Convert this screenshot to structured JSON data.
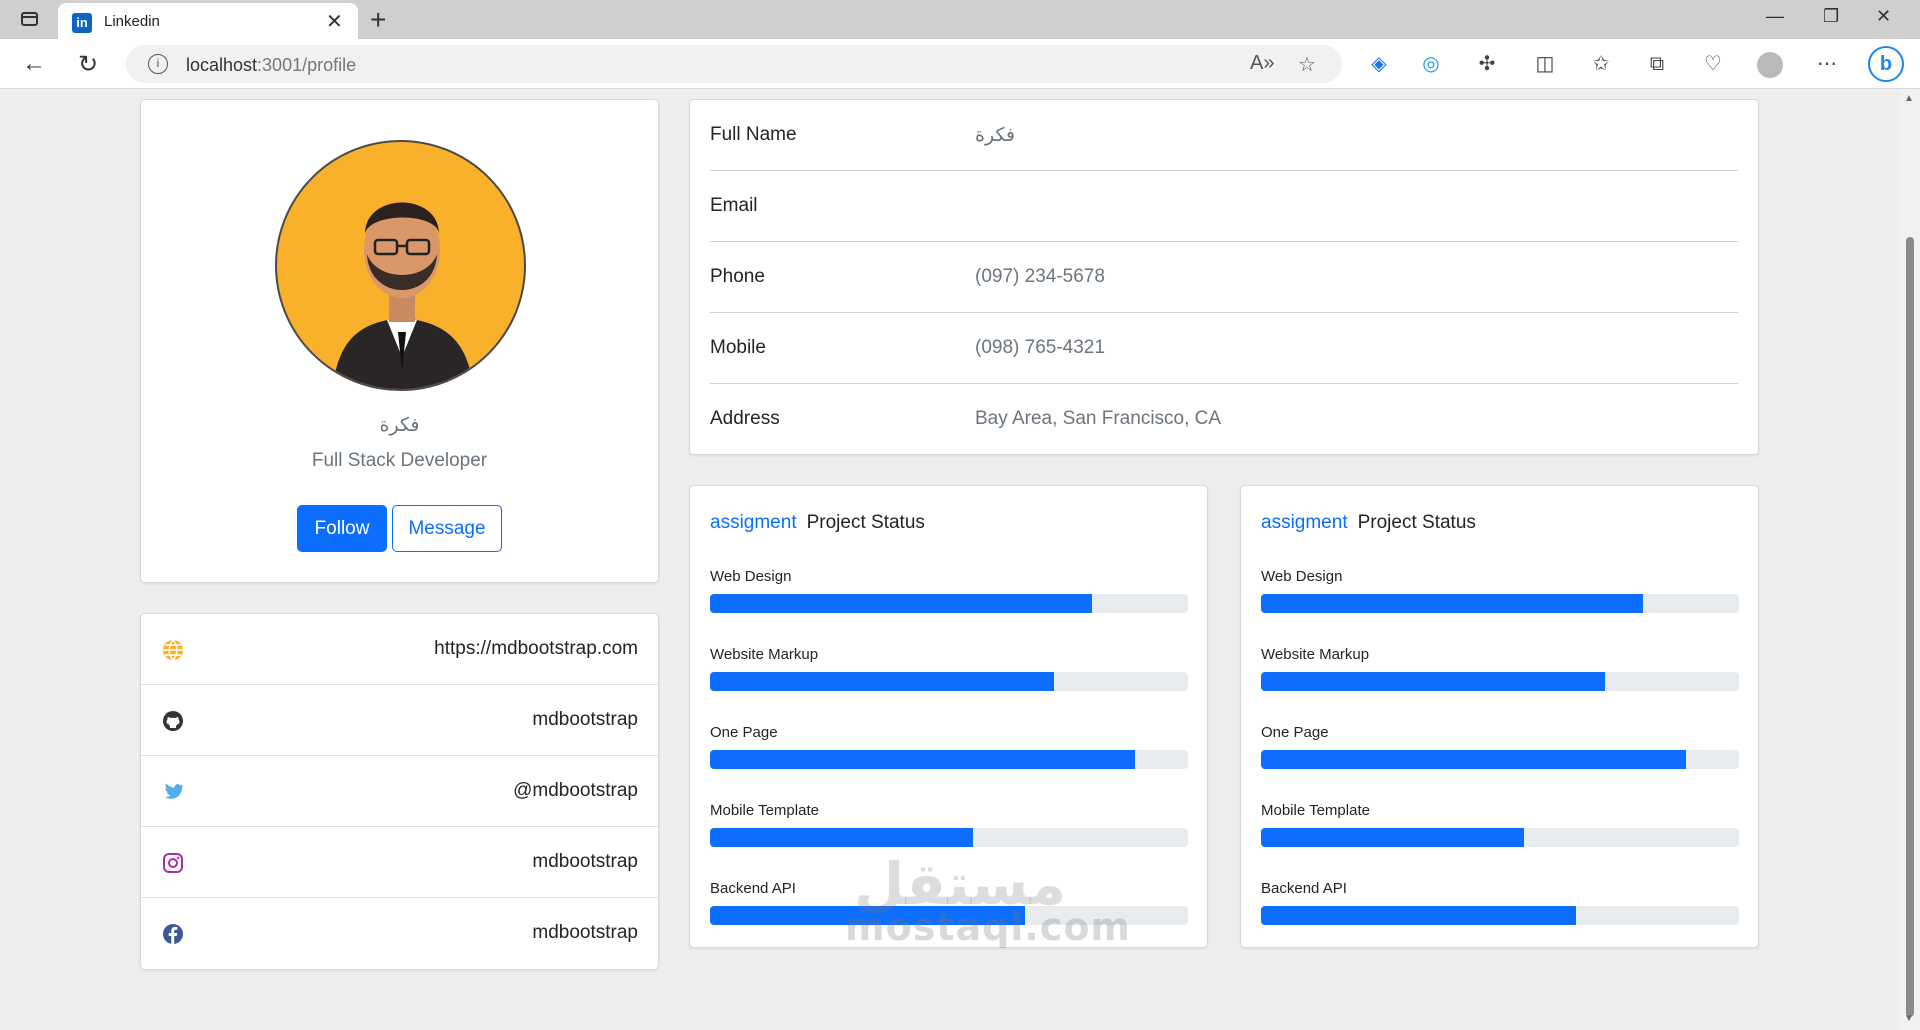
{
  "browser": {
    "tab_title": "Linkedin",
    "tab_favicon": "in",
    "url_host": "localhost",
    "url_rest": ":3001/profile",
    "bing_label": "b"
  },
  "profile": {
    "name": "فكرة",
    "title": "Full Stack Developer",
    "follow_label": "Follow",
    "message_label": "Message"
  },
  "links": [
    {
      "icon": "globe-icon",
      "text": "https://mdbootstrap.com",
      "color": "#f9b02a"
    },
    {
      "icon": "github-icon",
      "text": "mdbootstrap",
      "color": "#333333"
    },
    {
      "icon": "twitter-icon",
      "text": "@mdbootstrap",
      "color": "#55acee"
    },
    {
      "icon": "instagram-icon",
      "text": "mdbootstrap",
      "color": "#ac2bac"
    },
    {
      "icon": "facebook-icon",
      "text": "mdbootstrap",
      "color": "#3b5998"
    }
  ],
  "details": [
    {
      "label": "Full Name",
      "value": "فكرة"
    },
    {
      "label": "Email",
      "value": ""
    },
    {
      "label": "Phone",
      "value": "(097) 234-5678"
    },
    {
      "label": "Mobile",
      "value": "(098) 765-4321"
    },
    {
      "label": "Address",
      "value": "Bay Area, San Francisco, CA"
    }
  ],
  "status_cards": [
    {
      "tag": "assigment",
      "title": "Project Status",
      "items": [
        {
          "label": "Web Design",
          "percent": 80
        },
        {
          "label": "Website Markup",
          "percent": 72
        },
        {
          "label": "One Page",
          "percent": 89
        },
        {
          "label": "Mobile Template",
          "percent": 55
        },
        {
          "label": "Backend API",
          "percent": 66
        }
      ]
    },
    {
      "tag": "assigment",
      "title": "Project Status",
      "items": [
        {
          "label": "Web Design",
          "percent": 80
        },
        {
          "label": "Website Markup",
          "percent": 72
        },
        {
          "label": "One Page",
          "percent": 89
        },
        {
          "label": "Mobile Template",
          "percent": 55
        },
        {
          "label": "Backend API",
          "percent": 66
        }
      ]
    }
  ],
  "watermark": {
    "arabic": "مستقل",
    "latin": "mostaql.com"
  },
  "colors": {
    "primary": "#0d6efd",
    "avatar_bg": "#f9b02a",
    "track": "#e9ecef"
  }
}
